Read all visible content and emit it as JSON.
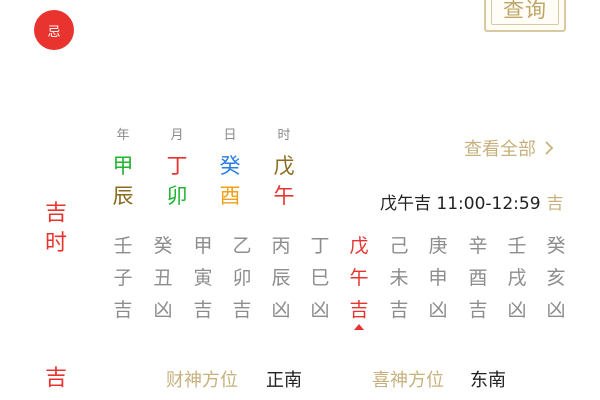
{
  "header": {
    "badge_label": "忌",
    "query_button_label": "查询"
  },
  "colors": {
    "red": "#e8332f",
    "gold": "#c7b27e",
    "green": "#22b532",
    "brown": "#8a6b1f",
    "blue": "#2a7de1",
    "orange": "#f0a21c",
    "grey": "#8d8d8d"
  },
  "pillars": [
    {
      "label": "年",
      "stem": "甲",
      "branch": "辰"
    },
    {
      "label": "月",
      "stem": "丁",
      "branch": "卯"
    },
    {
      "label": "日",
      "stem": "癸",
      "branch": "酉"
    },
    {
      "label": "时",
      "stem": "戊",
      "branch": "午"
    }
  ],
  "view_all_label": "查看全部",
  "current_hour": {
    "text": "戊午吉 11:00-12:59",
    "luck": "吉"
  },
  "section_labels": {
    "ji_shi_1": "吉",
    "ji_shi_2": "时",
    "bottom": "吉"
  },
  "hours": [
    {
      "stem": "壬",
      "branch": "子",
      "luck": "吉"
    },
    {
      "stem": "癸",
      "branch": "丑",
      "luck": "凶"
    },
    {
      "stem": "甲",
      "branch": "寅",
      "luck": "吉"
    },
    {
      "stem": "乙",
      "branch": "卯",
      "luck": "吉"
    },
    {
      "stem": "丙",
      "branch": "辰",
      "luck": "凶"
    },
    {
      "stem": "丁",
      "branch": "巳",
      "luck": "凶"
    },
    {
      "stem": "戊",
      "branch": "午",
      "luck": "吉"
    },
    {
      "stem": "己",
      "branch": "未",
      "luck": "吉"
    },
    {
      "stem": "庚",
      "branch": "申",
      "luck": "凶"
    },
    {
      "stem": "辛",
      "branch": "酉",
      "luck": "吉"
    },
    {
      "stem": "壬",
      "branch": "戌",
      "luck": "凶"
    },
    {
      "stem": "癸",
      "branch": "亥",
      "luck": "凶"
    }
  ],
  "active_hour_index": 6,
  "directions": {
    "wealth_title": "财神方位",
    "wealth_value": "正南",
    "joy_title": "喜神方位",
    "joy_value": "东南"
  }
}
